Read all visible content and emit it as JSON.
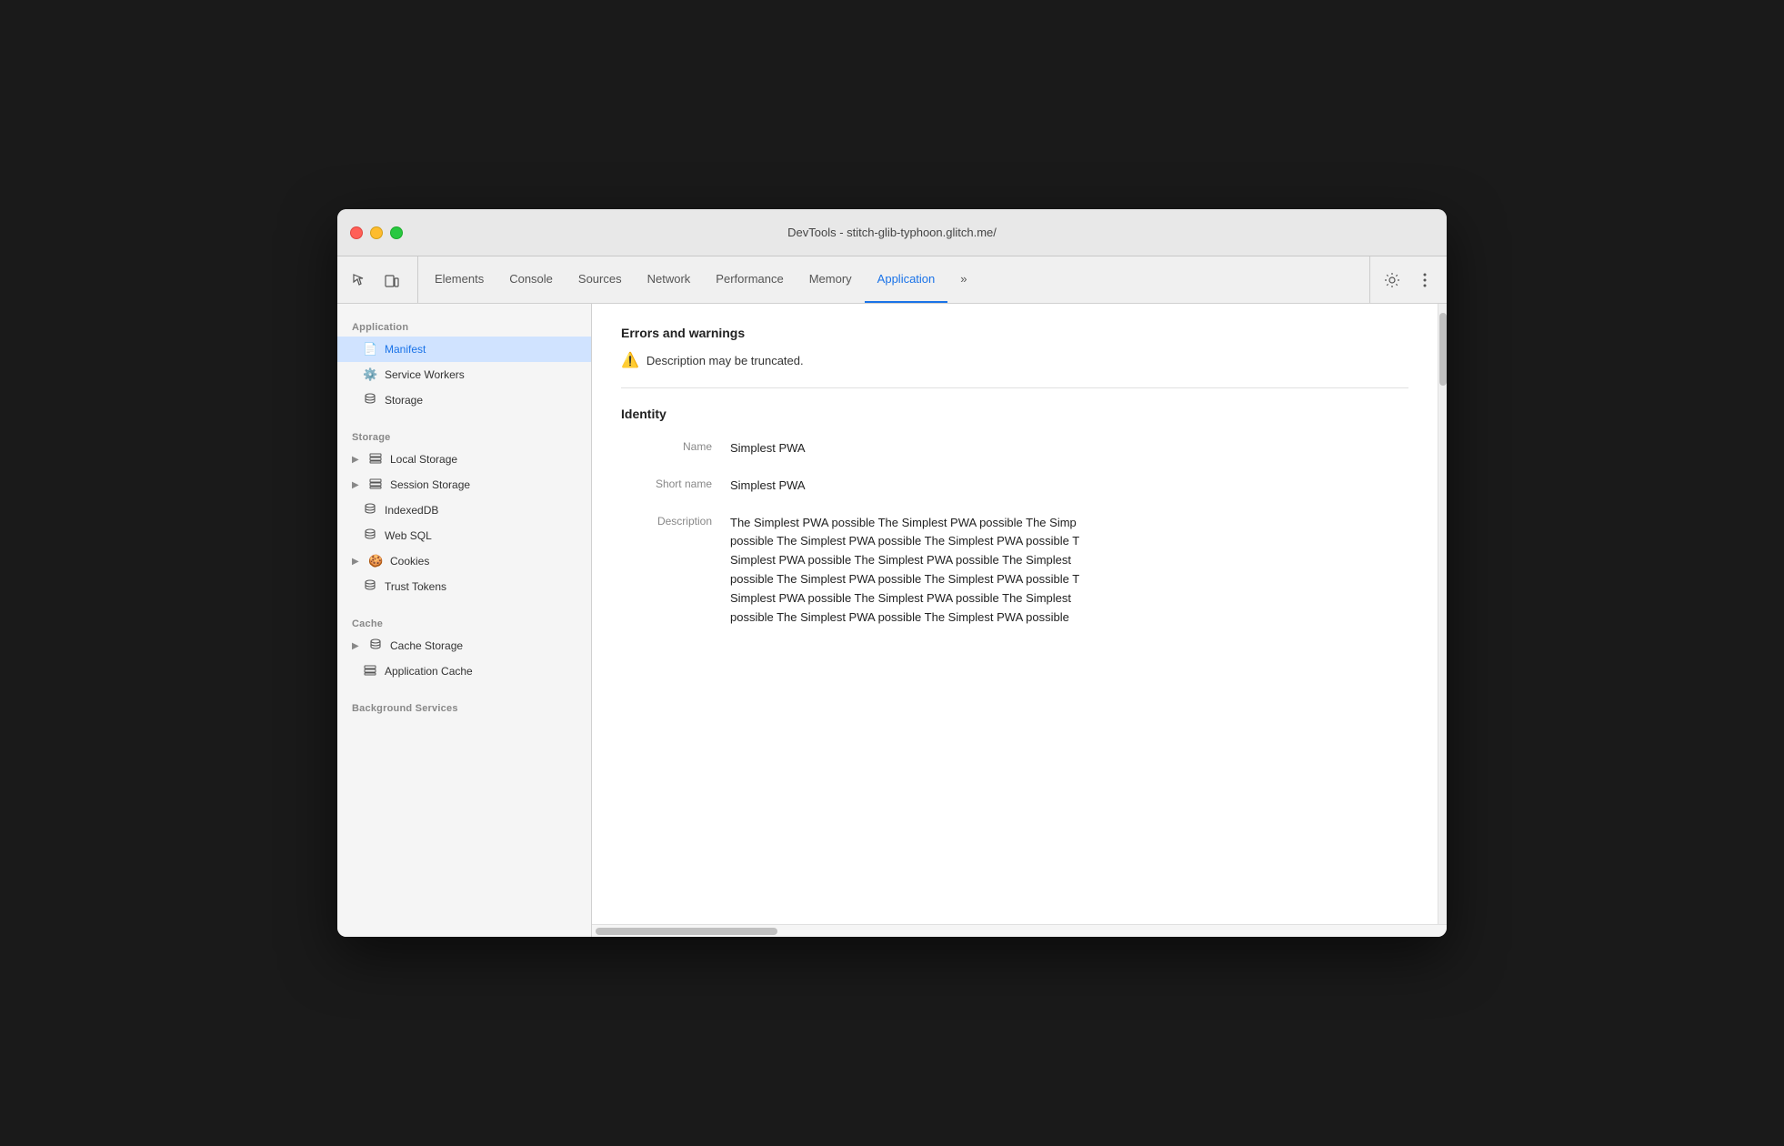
{
  "window": {
    "title": "DevTools - stitch-glib-typhoon.glitch.me/"
  },
  "toolbar": {
    "tabs": [
      {
        "id": "elements",
        "label": "Elements",
        "active": false
      },
      {
        "id": "console",
        "label": "Console",
        "active": false
      },
      {
        "id": "sources",
        "label": "Sources",
        "active": false
      },
      {
        "id": "network",
        "label": "Network",
        "active": false
      },
      {
        "id": "performance",
        "label": "Performance",
        "active": false
      },
      {
        "id": "memory",
        "label": "Memory",
        "active": false
      },
      {
        "id": "application",
        "label": "Application",
        "active": true
      }
    ],
    "more_label": "»"
  },
  "sidebar": {
    "application_label": "Application",
    "items_application": [
      {
        "id": "manifest",
        "label": "Manifest",
        "icon": "📄",
        "active": true
      },
      {
        "id": "service-workers",
        "label": "Service Workers",
        "icon": "⚙️",
        "active": false
      },
      {
        "id": "storage",
        "label": "Storage",
        "icon": "🗄️",
        "active": false
      }
    ],
    "storage_label": "Storage",
    "items_storage": [
      {
        "id": "local-storage",
        "label": "Local Storage",
        "icon": "▦",
        "hasArrow": true,
        "active": false
      },
      {
        "id": "session-storage",
        "label": "Session Storage",
        "icon": "▦",
        "hasArrow": true,
        "active": false
      },
      {
        "id": "indexeddb",
        "label": "IndexedDB",
        "icon": "🗄",
        "active": false
      },
      {
        "id": "web-sql",
        "label": "Web SQL",
        "icon": "🗄",
        "active": false
      },
      {
        "id": "cookies",
        "label": "Cookies",
        "icon": "🍪",
        "hasArrow": true,
        "active": false
      },
      {
        "id": "trust-tokens",
        "label": "Trust Tokens",
        "icon": "🗄",
        "active": false
      }
    ],
    "cache_label": "Cache",
    "items_cache": [
      {
        "id": "cache-storage",
        "label": "Cache Storage",
        "icon": "🗄",
        "hasArrow": true,
        "active": false
      },
      {
        "id": "application-cache",
        "label": "Application Cache",
        "icon": "▦",
        "active": false
      }
    ],
    "background_label": "Background Services"
  },
  "content": {
    "errors_title": "Errors and warnings",
    "warning_text": "Description may be truncated.",
    "identity_title": "Identity",
    "fields": [
      {
        "label": "Name",
        "value": "Simplest PWA"
      },
      {
        "label": "Short name",
        "value": "Simplest PWA"
      },
      {
        "label": "Description",
        "value": "The Simplest PWA possible The Simplest PWA possible The Simp\npossible The Simplest PWA possible The Simplest PWA possible T\nSimplest PWA possible The Simplest PWA possible The Simplest\npossible The Simplest PWA possible The Simplest PWA possible T\nSimplest PWA possible The Simplest PWA possible The Simplest\npossible The Simplest PWA possible The Simplest PWA possible"
      }
    ]
  }
}
